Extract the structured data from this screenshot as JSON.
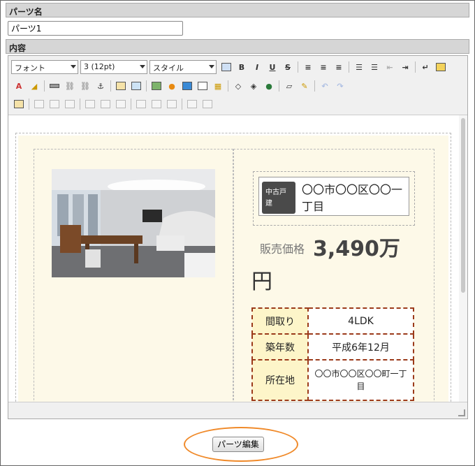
{
  "parts_name": {
    "header": "パーツ名",
    "value": "パーツ1"
  },
  "content": {
    "header": "内容"
  },
  "toolbar": {
    "font_select": "フォント",
    "size_select": "3 (12pt)",
    "style_select": "スタイル",
    "bold": "B",
    "italic": "I",
    "underline": "U",
    "strike": "S"
  },
  "listing": {
    "tag": "中古戸建",
    "address": "〇〇市〇〇区〇〇一丁目",
    "price_label": "販売価格",
    "price_value": "3,490万",
    "price_unit": "円",
    "specs": [
      {
        "key": "間取り",
        "value": "4LDK"
      },
      {
        "key": "築年数",
        "value": "平成6年12月"
      },
      {
        "key": "所在地",
        "value": "〇〇市〇〇区〇〇町一丁目"
      }
    ]
  },
  "footer": {
    "edit_button": "パーツ編集"
  },
  "colors": {
    "cream": "#fdf9e8",
    "table_border": "#9b3a1a",
    "highlight_ring": "#f08a2a"
  }
}
